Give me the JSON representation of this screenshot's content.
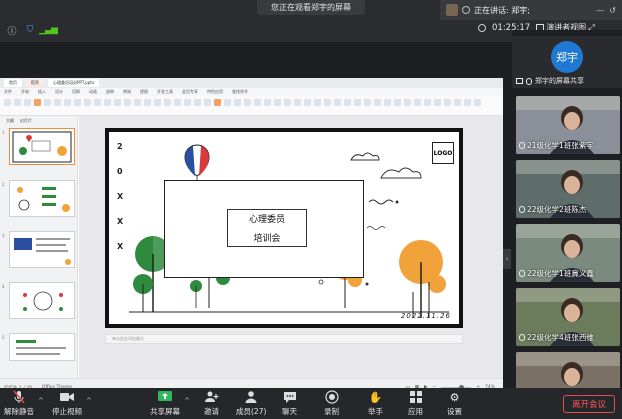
{
  "header": {
    "viewing_banner": "您正在观看郑宇的屏幕",
    "speaker_label": "正在讲话: 郑宇;",
    "timer": "01:25:17",
    "view_label": "演讲者视图"
  },
  "document": {
    "tabs": [
      "首页",
      "稻壳",
      "心理委员培训PPT.pptx"
    ],
    "menu": [
      "文件",
      "开始",
      "插入",
      "设计",
      "切换",
      "动画",
      "放映",
      "审阅",
      "视图",
      "开发工具",
      "会员专享",
      "特色应用",
      "查找命令"
    ],
    "thumb_tabs": [
      "大纲",
      "幻灯片"
    ],
    "thumb_numbers": [
      "1",
      "2",
      "3",
      "4",
      "5"
    ],
    "notes_placeholder": "单击此处添加备注",
    "status_slide": "幻灯片 1 / 20",
    "status_theme": "Office Theme",
    "zoom": "74%"
  },
  "slide": {
    "vertical_letters": [
      "2",
      "0",
      "X",
      "X",
      "X"
    ],
    "title_line1": "心理委员",
    "title_line2": "培训会",
    "logo": "LOGO",
    "date": "2022.11.26"
  },
  "gallery": {
    "self_avatar": "郑宇",
    "self_caption": "郑宇的屏幕共享",
    "participants": [
      {
        "name": "21级化学1班张紫宇",
        "bg": "#8a8f99"
      },
      {
        "name": "22级化学2班陈杰",
        "bg": "#5e6d6a"
      },
      {
        "name": "22级化学1班冀义鑫",
        "bg": "#7a8a7e"
      },
      {
        "name": "22级化学4班张西维",
        "bg": "#6b7c5d"
      },
      {
        "name": "",
        "bg": "#7a7066"
      }
    ]
  },
  "toolbar": {
    "mute": "解除静音",
    "video": "停止视频",
    "share": "共享屏幕",
    "invite": "邀请",
    "members": "成员(27)",
    "chat": "聊天",
    "record": "录制",
    "raise_hand": "举手",
    "apps": "应用",
    "settings": "设置",
    "leave": "离开会议"
  },
  "colors": {
    "leave": "#e54b4b",
    "accent": "#1f78d1",
    "slide_green": "#2e8b3e",
    "slide_orange": "#f2a23a",
    "slide_red": "#d83a3a",
    "slide_blue": "#2a4fa0"
  }
}
